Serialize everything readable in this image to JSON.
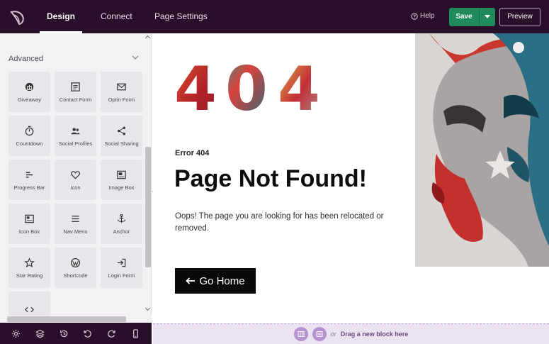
{
  "topbar": {
    "tabs": [
      {
        "label": "Design",
        "active": true
      },
      {
        "label": "Connect",
        "active": false
      },
      {
        "label": "Page Settings",
        "active": false
      }
    ],
    "help_label": "Help",
    "save_label": "Save",
    "preview_label": "Preview",
    "colors": {
      "bar": "#2a0f2b",
      "save": "#1f8a5a"
    }
  },
  "sidebar": {
    "section_title": "Advanced",
    "widgets": [
      {
        "label": "Giveaway",
        "icon": "giveaway-icon"
      },
      {
        "label": "Contact Form",
        "icon": "contact-form-icon"
      },
      {
        "label": "Optin Form",
        "icon": "envelope-icon"
      },
      {
        "label": "Countdown",
        "icon": "stopwatch-icon"
      },
      {
        "label": "Social Profiles",
        "icon": "people-icon"
      },
      {
        "label": "Social Sharing",
        "icon": "share-icon"
      },
      {
        "label": "Progress Bar",
        "icon": "progress-bar-icon"
      },
      {
        "label": "Icon",
        "icon": "heart-icon"
      },
      {
        "label": "Image Box",
        "icon": "image-box-icon"
      },
      {
        "label": "Icon Box",
        "icon": "icon-box-icon"
      },
      {
        "label": "Nav Menu",
        "icon": "menu-icon"
      },
      {
        "label": "Anchor",
        "icon": "anchor-icon"
      },
      {
        "label": "Star Rating",
        "icon": "star-icon"
      },
      {
        "label": "Shortcode",
        "icon": "wordpress-icon"
      },
      {
        "label": "Login Form",
        "icon": "login-icon"
      },
      {
        "label": "",
        "icon": "code-icon"
      }
    ]
  },
  "bottombar": {
    "icons": [
      "settings-icon",
      "layers-icon",
      "history-icon",
      "undo-icon",
      "redo-icon",
      "mobile-preview-icon"
    ]
  },
  "page": {
    "code": "404",
    "error_label": "Error 404",
    "title": "Page Not Found!",
    "message": "Oops! The page you are looking for has been relocated or removed.",
    "button_label": "Go Home",
    "drop_or": "or",
    "drop_label": "Drag a new block here"
  }
}
